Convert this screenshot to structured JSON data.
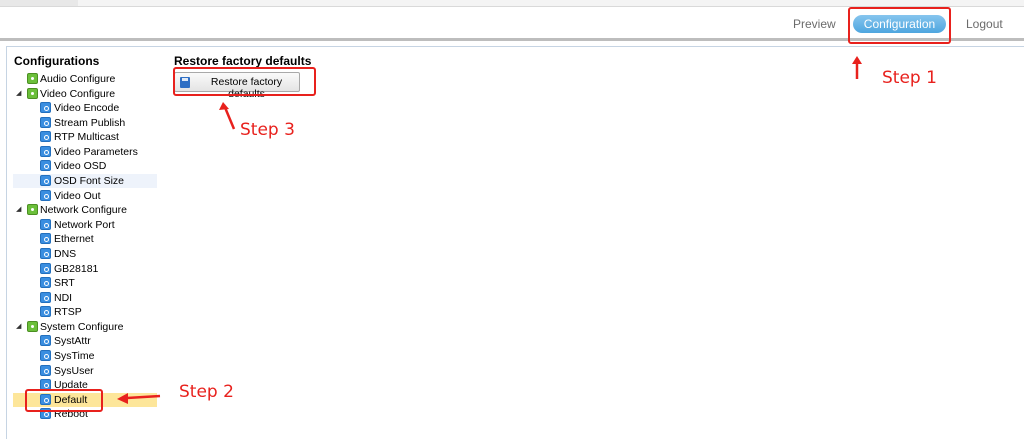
{
  "header": {
    "nav": {
      "preview": "Preview",
      "configuration": "Configuration",
      "logout": "Logout"
    }
  },
  "sidebar": {
    "title": "Configurations",
    "items": [
      {
        "label": "Audio Configure",
        "type": "group",
        "toggle": ""
      },
      {
        "label": "Video Configure",
        "type": "group",
        "toggle": "expanded"
      },
      {
        "label": "Video Encode",
        "type": "leaf"
      },
      {
        "label": "Stream Publish",
        "type": "leaf"
      },
      {
        "label": "RTP Multicast",
        "type": "leaf"
      },
      {
        "label": "Video Parameters",
        "type": "leaf"
      },
      {
        "label": "Video OSD",
        "type": "leaf"
      },
      {
        "label": "OSD Font Size",
        "type": "leaf"
      },
      {
        "label": "Video Out",
        "type": "leaf"
      },
      {
        "label": "Network Configure",
        "type": "group",
        "toggle": "expanded"
      },
      {
        "label": "Network Port",
        "type": "leaf"
      },
      {
        "label": "Ethernet",
        "type": "leaf"
      },
      {
        "label": "DNS",
        "type": "leaf"
      },
      {
        "label": "GB28181",
        "type": "leaf"
      },
      {
        "label": "SRT",
        "type": "leaf"
      },
      {
        "label": "NDI",
        "type": "leaf"
      },
      {
        "label": "RTSP",
        "type": "leaf"
      },
      {
        "label": "System Configure",
        "type": "group",
        "toggle": "expanded"
      },
      {
        "label": "SystAttr",
        "type": "leaf"
      },
      {
        "label": "SysTime",
        "type": "leaf"
      },
      {
        "label": "SysUser",
        "type": "leaf"
      },
      {
        "label": "Update",
        "type": "leaf"
      },
      {
        "label": "Default",
        "type": "leaf",
        "selected": true
      },
      {
        "label": "Reboot",
        "type": "leaf"
      }
    ]
  },
  "main": {
    "title": "Restore factory defaults",
    "restore_button": "Restore factory defaults"
  },
  "annotations": {
    "step1": "Step 1",
    "step2": "Step 2",
    "step3": "Step 3",
    "color": "#e8211d"
  },
  "colors": {
    "accent": "#4ea6df",
    "selected_row": "#fde69a",
    "hover_row": "#eef3fb"
  }
}
